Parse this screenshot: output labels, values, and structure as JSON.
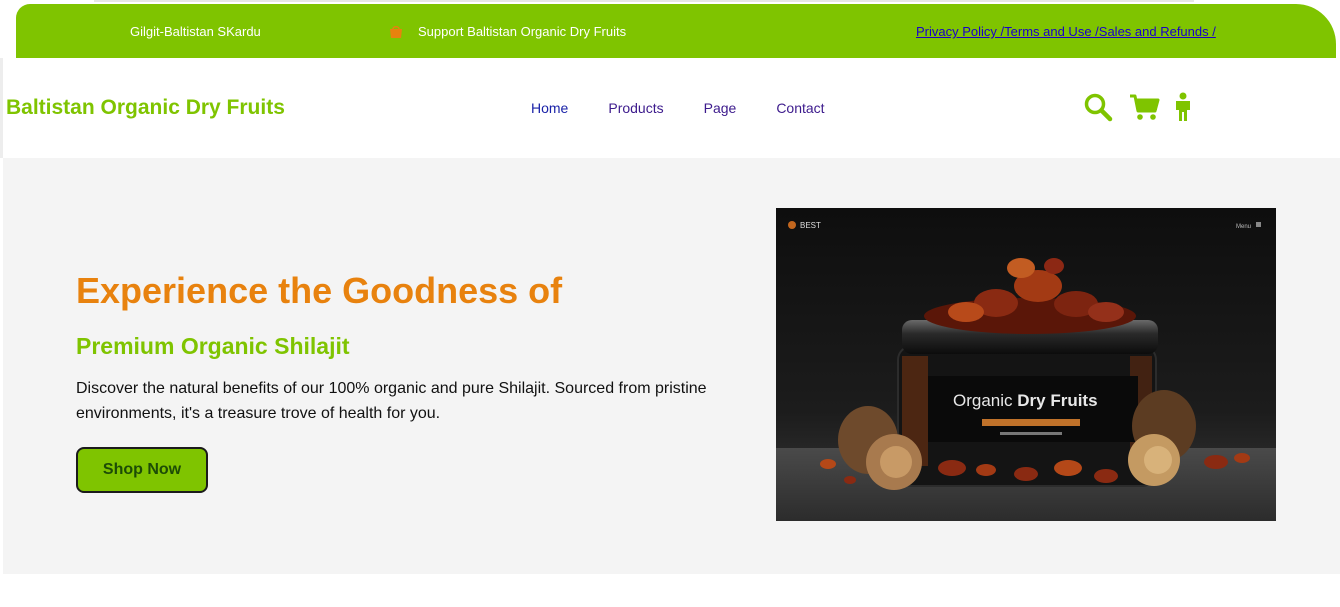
{
  "topbar": {
    "location": "Gilgit-Baltistan SKardu",
    "support": "Support Baltistan Organic Dry Fruits",
    "policy_links": "Privacy Policy /Terms and Use /Sales and Refunds /"
  },
  "header": {
    "brand": "Baltistan Organic Dry Fruits",
    "nav": {
      "home": "Home",
      "products": "Products",
      "page": "Page",
      "contact": "Contact"
    },
    "icons": [
      "search-icon",
      "cart-icon",
      "person-icon"
    ]
  },
  "hero": {
    "title": "Experience the Goodness of",
    "subtitle": "Premium Organic Shilajit",
    "description": "Discover the natural benefits of our 100% organic and pure Shilajit. Sourced from pristine environments, it's a treasure trove of health for you.",
    "cta": "Shop Now",
    "image": {
      "jar_label_prefix": "Organic ",
      "jar_label_bold": "Dry Fruits",
      "logo_text": "BEST",
      "menu_text": "Menu"
    }
  },
  "colors": {
    "brand_green": "#7fc400",
    "accent_orange": "#e8820e",
    "nav_purple": "#3c1a8c",
    "hero_bg": "#f4f4f4"
  }
}
